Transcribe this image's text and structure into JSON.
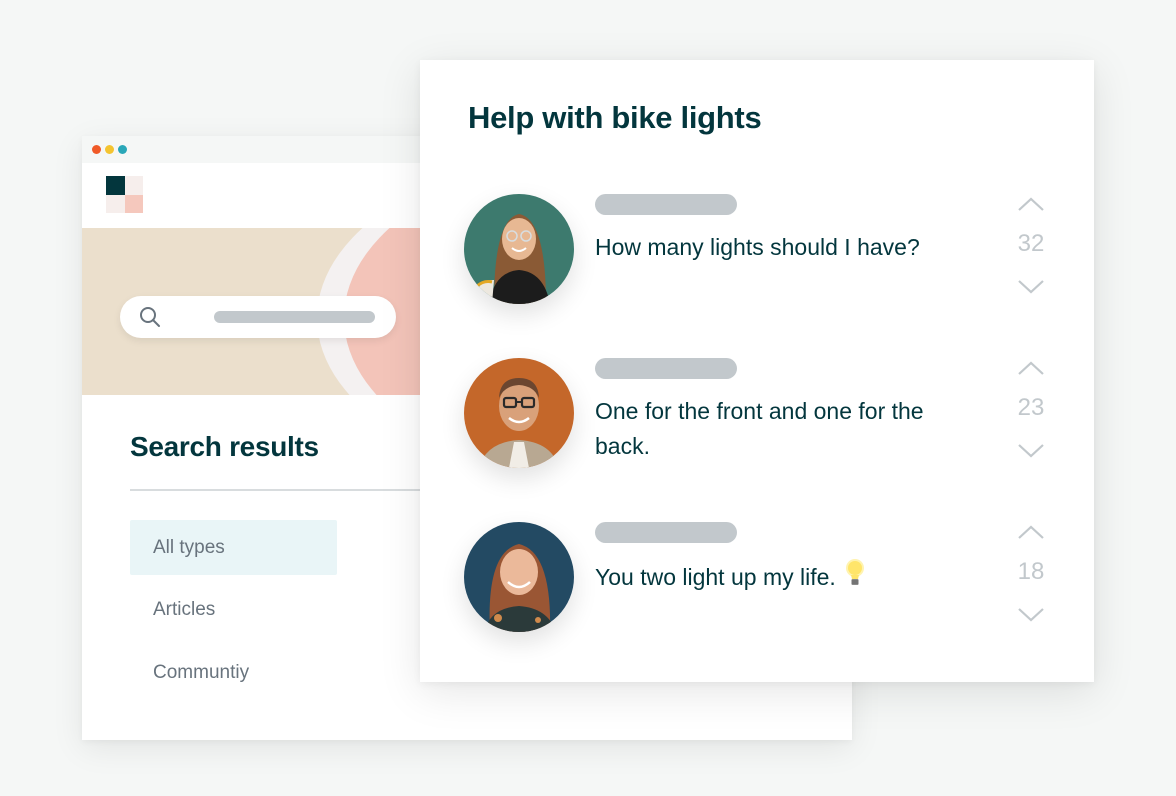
{
  "back_window": {
    "traffic_lights": [
      "#f05a28",
      "#f4c430",
      "#2aa7b8"
    ],
    "logo_colors": [
      "#03363d",
      "#f6eeec",
      "#f6eeec",
      "#f5c8bd"
    ],
    "search": {
      "icon": "search-icon",
      "placeholder": ""
    },
    "results_title": "Search results",
    "filters": [
      {
        "label": "All types",
        "active": true
      },
      {
        "label": "Articles",
        "active": false
      },
      {
        "label": "Communtiy",
        "active": false
      }
    ]
  },
  "qa_card": {
    "title": "Help with bike lights",
    "posts": [
      {
        "text": "How many lights should I have?",
        "votes": "32",
        "avatar_bg": "#3d7a6e",
        "emoji": ""
      },
      {
        "text": "One for the front and one for the back.",
        "votes": "23",
        "avatar_bg": "#c4672a",
        "emoji": ""
      },
      {
        "text": "You two light up my life.",
        "votes": "18",
        "avatar_bg": "#234a63",
        "emoji": "lightbulb-icon"
      }
    ]
  },
  "colors": {
    "primary_text": "#03363d",
    "muted_text": "#68737d",
    "placeholder_bar": "#c2c8cc",
    "active_filter_bg": "#e9f5f7",
    "hero_beige": "#ebdfcc",
    "hero_pink": "#f3c4b9"
  }
}
